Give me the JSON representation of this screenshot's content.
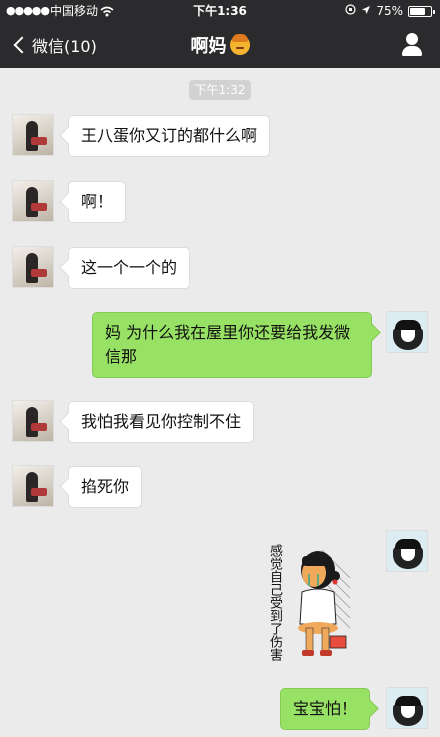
{
  "status_bar": {
    "signal": "●●●●●",
    "carrier": "中国移动",
    "time": "下午1:36",
    "battery": "75%",
    "battery_level": 0.75
  },
  "nav": {
    "back_label": "微信(10)",
    "title": "啊妈",
    "title_emoji": "older-woman-emoji"
  },
  "timestamp": "下午1:32",
  "messages": [
    {
      "side": "left",
      "text": "王八蛋你又订的都什么啊"
    },
    {
      "side": "left",
      "text": "啊！"
    },
    {
      "side": "left",
      "text": "这一个一个的"
    },
    {
      "side": "right",
      "text": "妈 为什么我在屋里你还要给我发微信那"
    },
    {
      "side": "left",
      "text": "我怕我看见你控制不住"
    },
    {
      "side": "left",
      "text": "掐死你"
    },
    {
      "side": "right",
      "sticker_text": "感觉自己受到了伤害"
    },
    {
      "side": "right",
      "text": "宝宝怕！"
    }
  ],
  "icons": {
    "back": "chevron-left-icon",
    "profile": "person-icon",
    "wifi": "wifi-icon",
    "location": "location-arrow-icon",
    "lock": "rotation-lock-icon"
  },
  "colors": {
    "nav_bg": "#2b2b2d",
    "chat_bg": "#ebebeb",
    "bubble_left": "#ffffff",
    "bubble_right": "#97e164"
  }
}
